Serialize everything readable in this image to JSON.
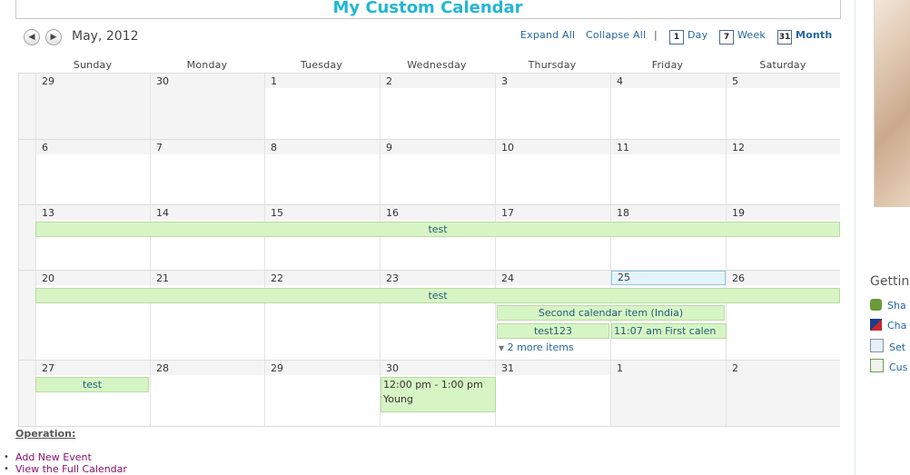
{
  "title": "My Custom Calendar",
  "month_label": "May, 2012",
  "nav": {
    "prev_icon": "arrow-left-icon",
    "next_icon": "arrow-right-icon"
  },
  "toolbar": {
    "expand_all": "Expand All",
    "collapse_all": "Collapse All",
    "separator": "|",
    "day": "Day",
    "week": "Week",
    "month": "Month",
    "day_icon_num": "1",
    "week_icon_num": "7",
    "month_icon_num": "31"
  },
  "weekdays": [
    "Sunday",
    "Monday",
    "Tuesday",
    "Wednesday",
    "Thursday",
    "Friday",
    "Saturday"
  ],
  "weeks": [
    [
      "29",
      "30",
      "1",
      "2",
      "3",
      "4",
      "5"
    ],
    [
      "6",
      "7",
      "8",
      "9",
      "10",
      "11",
      "12"
    ],
    [
      "13",
      "14",
      "15",
      "16",
      "17",
      "18",
      "19"
    ],
    [
      "20",
      "21",
      "22",
      "23",
      "24",
      "25",
      "26"
    ],
    [
      "27",
      "28",
      "29",
      "30",
      "31",
      "1",
      "2"
    ]
  ],
  "events": {
    "week3_test": "test",
    "week4_test": "test",
    "second_item": "Second calendar item (India)",
    "test123": "test123",
    "first_calendar": "11:07 am First calen",
    "more_items": "2 more items",
    "week5_test": "test",
    "young_time": "12:00 pm - 1:00 pm",
    "young_title": "Young"
  },
  "operation": {
    "label": "Operation:",
    "add_event": "Add New Event",
    "view_full": "View the Full Calendar",
    "bullet": "•"
  },
  "right_panel": {
    "heading": "Gettin",
    "items": [
      "Sha",
      "Cha",
      "Set",
      "Cus"
    ]
  },
  "colors": {
    "title": "#22b6d6",
    "event_bg": "#d7f5c4",
    "today_bg": "#e4f4fc",
    "link": "#2466a0",
    "op_link": "#8a1070"
  }
}
